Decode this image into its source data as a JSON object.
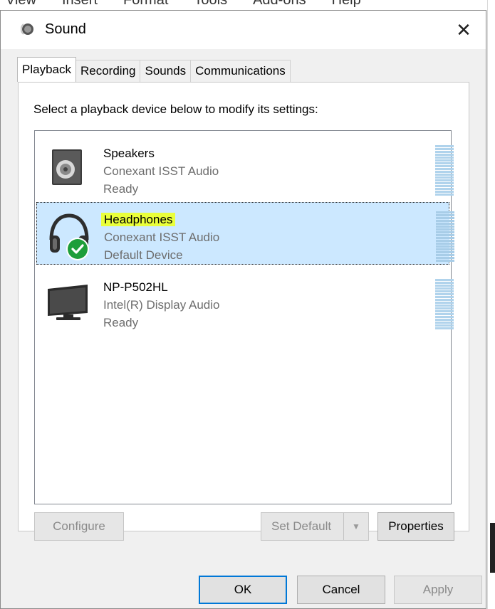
{
  "background_app": {
    "menu_items": [
      "View",
      "Insert",
      "Format",
      "Tools",
      "Add-ons",
      "Help"
    ]
  },
  "window": {
    "title": "Sound",
    "close_glyph": "✕",
    "icon": "speaker-icon"
  },
  "tabs": [
    {
      "label": "Playback",
      "active": true
    },
    {
      "label": "Recording",
      "active": false
    },
    {
      "label": "Sounds",
      "active": false
    },
    {
      "label": "Communications",
      "active": false
    }
  ],
  "playback": {
    "instruction": "Select a playback device below to modify its settings:",
    "devices": [
      {
        "name": "Speakers",
        "driver": "Conexant ISST Audio",
        "status": "Ready",
        "icon": "speaker-icon",
        "selected": false
      },
      {
        "name": "Headphones",
        "driver": "Conexant ISST Audio",
        "status": "Default Device",
        "icon": "headphones-icon",
        "selected": true,
        "badge": "checkmark-badge-icon"
      },
      {
        "name": "NP-P502HL",
        "driver": "Intel(R) Display Audio",
        "status": "Ready",
        "icon": "monitor-icon",
        "selected": false
      }
    ],
    "buttons": {
      "configure": "Configure",
      "set_default": "Set Default",
      "set_default_arrow": "▼",
      "properties": "Properties"
    }
  },
  "footer": {
    "ok": "OK",
    "cancel": "Cancel",
    "apply": "Apply"
  },
  "colors": {
    "selection": "#cce8ff",
    "highlight": "#eaff3a",
    "accent": "#0078d7",
    "badge": "#1e9e3a"
  }
}
